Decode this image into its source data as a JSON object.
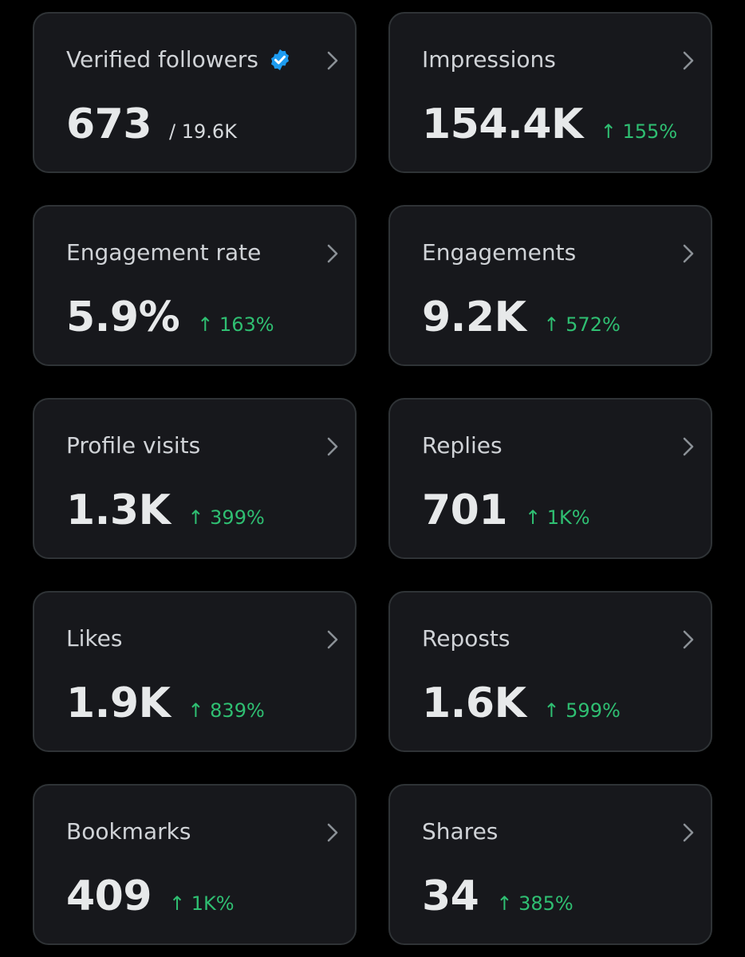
{
  "colors": {
    "background": "#000000",
    "card": "#17181c",
    "card_border": "#2f3336",
    "label": "#d0d3d7",
    "value": "#e7e9ea",
    "positive_change": "#2fbf72",
    "verified_badge": "#1d9bf0"
  },
  "metrics": [
    {
      "label": "Verified followers",
      "value": "673",
      "subtotal": "/ 19.6K",
      "change": "",
      "verified": true,
      "icon": "chevron-right-icon"
    },
    {
      "label": "Impressions",
      "value": "154.4K",
      "change": "↑ 155%",
      "icon": "chevron-right-icon"
    },
    {
      "label": "Engagement rate",
      "value": "5.9%",
      "change": "↑ 163%",
      "icon": "chevron-right-icon"
    },
    {
      "label": "Engagements",
      "value": "9.2K",
      "change": "↑ 572%",
      "icon": "chevron-right-icon"
    },
    {
      "label": "Profile visits",
      "value": "1.3K",
      "change": "↑ 399%",
      "icon": "chevron-right-icon"
    },
    {
      "label": "Replies",
      "value": "701",
      "change": "↑ 1K%",
      "icon": "chevron-right-icon"
    },
    {
      "label": "Likes",
      "value": "1.9K",
      "change": "↑ 839%",
      "icon": "chevron-right-icon"
    },
    {
      "label": "Reposts",
      "value": "1.6K",
      "change": "↑ 599%",
      "icon": "chevron-right-icon"
    },
    {
      "label": "Bookmarks",
      "value": "409",
      "change": "↑ 1K%",
      "icon": "chevron-right-icon"
    },
    {
      "label": "Shares",
      "value": "34",
      "change": "↑ 385%",
      "icon": "chevron-right-icon"
    }
  ]
}
